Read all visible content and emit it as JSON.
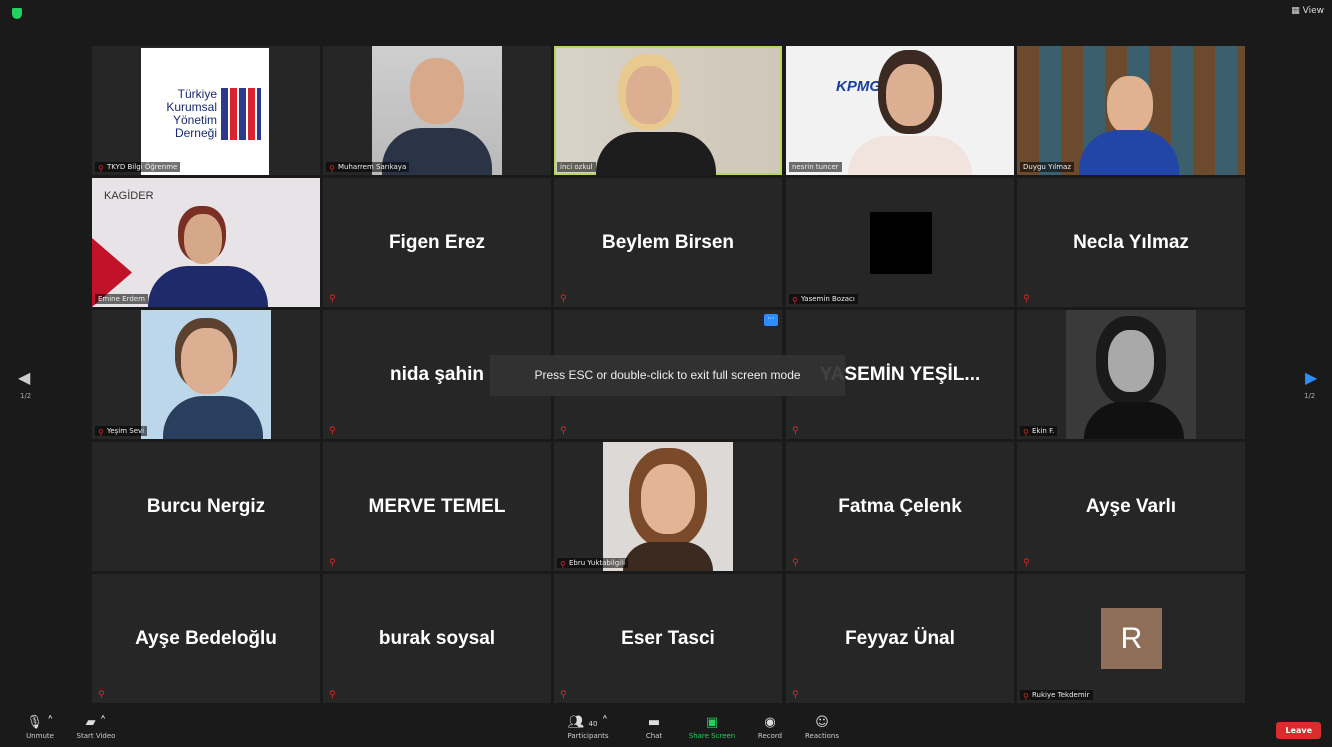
{
  "topbar": {
    "view_label": "View"
  },
  "nav": {
    "prev_page": "1/2",
    "next_page": "1/2"
  },
  "toast": "Press ESC or double-click to exit full screen mode",
  "tiles": [
    {
      "label": "TKYD Bilgi Öğrenme",
      "logo_lines": [
        "Türkiye",
        "Kurumsal",
        "Yönetim",
        "Derneği"
      ]
    },
    {
      "label": "Muharrem Sarıkaya"
    },
    {
      "label": "inci ozkul"
    },
    {
      "label": "nesrin tuncer",
      "logo_text": "KPMG"
    },
    {
      "label": "Duygu Yılmaz"
    },
    {
      "label": "Emine Erdem",
      "logo_text": "KAGİDER"
    },
    {
      "name": "Figen Erez"
    },
    {
      "name": "Beylem Birsen"
    },
    {
      "label": "Yasemin Bozacı"
    },
    {
      "name": "Necla Yılmaz"
    },
    {
      "label": "Yeşim Sevi"
    },
    {
      "name": "nida şahin"
    },
    {
      "name": ""
    },
    {
      "name": "YASEMİN  YEŞİL..."
    },
    {
      "label": "Ekin F."
    },
    {
      "name": "Burcu Nergiz"
    },
    {
      "name": "MERVE TEMEL"
    },
    {
      "label": "Ebru Yuktabilgili"
    },
    {
      "name": "Fatma Çelenk"
    },
    {
      "name": "Ayşe Varlı"
    },
    {
      "name": "Ayşe Bedeloğlu"
    },
    {
      "name": "burak soysal"
    },
    {
      "name": "Eser Tasci"
    },
    {
      "name": "Feyyaz Ünal"
    },
    {
      "label": "Rukiye Tekdemir",
      "avatar_letter": "R"
    }
  ],
  "toolbar": {
    "unmute": "Unmute",
    "start_video": "Start Video",
    "participants": "Participants",
    "participants_count": "40",
    "chat": "Chat",
    "share_screen": "Share Screen",
    "record": "Record",
    "reactions": "Reactions",
    "leave": "Leave"
  },
  "colors": {
    "active_speaker": "#b7d85a",
    "leave": "#d92d2d",
    "share": "#23d160"
  }
}
